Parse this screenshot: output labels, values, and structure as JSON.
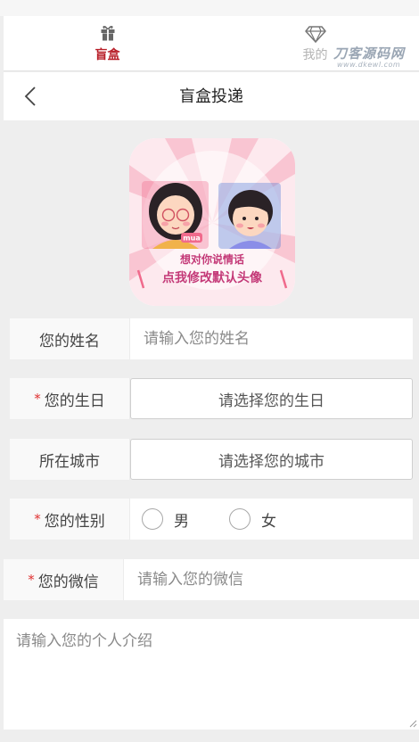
{
  "tabs": [
    {
      "label": "盲盒",
      "icon": "gift-icon",
      "active": true
    },
    {
      "label": "我的",
      "icon": "diamond-icon",
      "active": false
    }
  ],
  "watermark": {
    "text": "刀客源码网",
    "sub": "www.dkewl.com"
  },
  "navbar": {
    "title": "盲盒投递",
    "back_icon": "back-arrow-icon"
  },
  "avatar": {
    "line1": "想对你说情话",
    "line2": "点我修改默认头像",
    "badge": "mua"
  },
  "form": {
    "name": {
      "label": "您的姓名",
      "placeholder": "请输入您的姓名",
      "required": false
    },
    "birthday": {
      "label": "您的生日",
      "value": "请选择您的生日",
      "required": true
    },
    "city": {
      "label": "所在城市",
      "value": "请选择您的城市",
      "required": false
    },
    "gender": {
      "label": "您的性别",
      "options": [
        "男",
        "女"
      ],
      "required": true
    },
    "wechat": {
      "label": "您的微信",
      "placeholder": "请输入您的微信",
      "required": true
    },
    "intro": {
      "placeholder": "请输入您的个人介绍"
    },
    "required_mark": "*"
  },
  "colors": {
    "accent": "#b81e28",
    "required": "#e03030",
    "background": "#eeeeee"
  }
}
